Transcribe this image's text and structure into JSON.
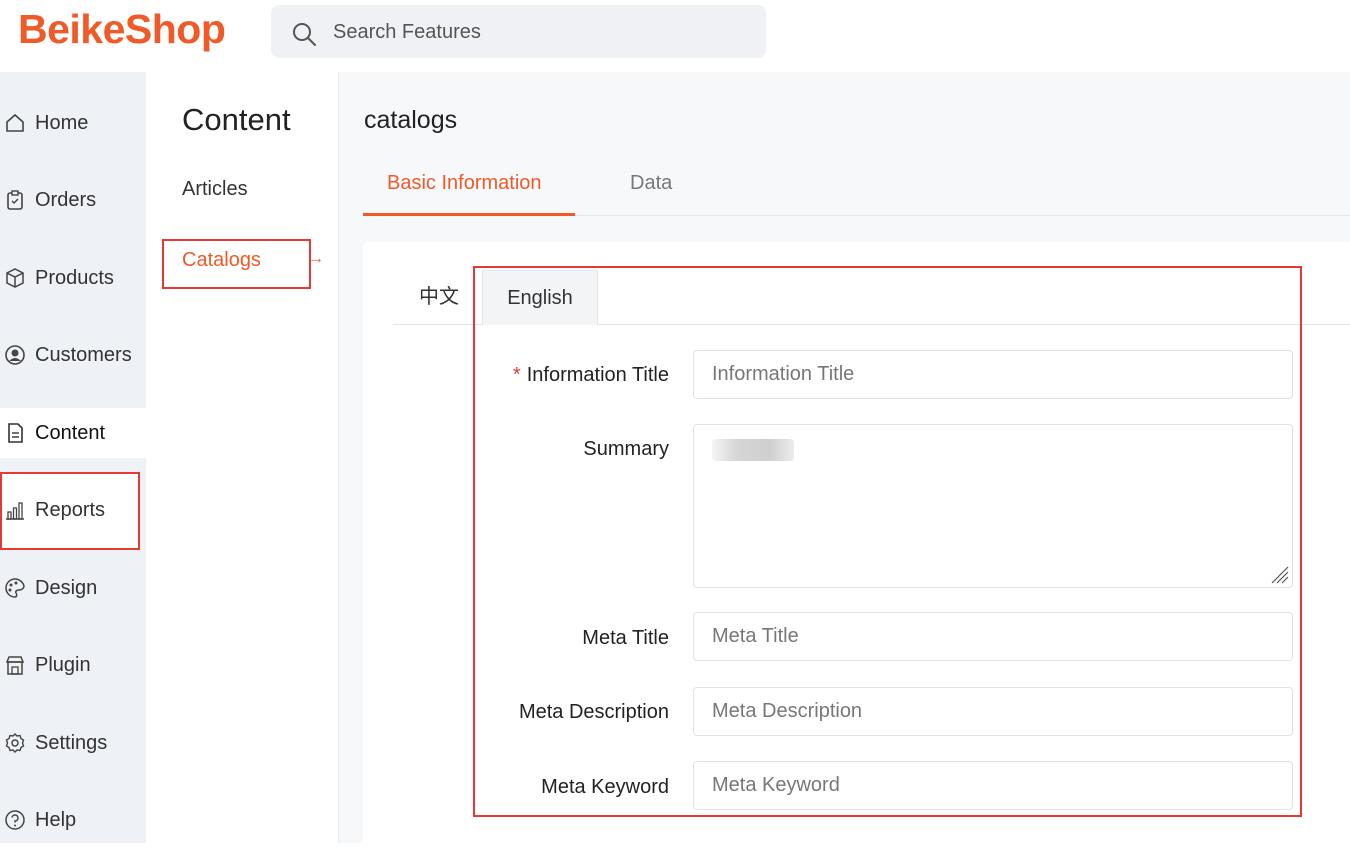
{
  "brand": {
    "logo_text": "BeikeShop",
    "accent": "#f05a28"
  },
  "search": {
    "placeholder": "Search Features"
  },
  "sidebar": {
    "items": [
      {
        "label": "Home",
        "icon": "home-icon"
      },
      {
        "label": "Orders",
        "icon": "clipboard-icon"
      },
      {
        "label": "Products",
        "icon": "box-icon"
      },
      {
        "label": "Customers",
        "icon": "user-circle-icon"
      },
      {
        "label": "Content",
        "icon": "document-icon"
      },
      {
        "label": "Reports",
        "icon": "bar-chart-icon"
      },
      {
        "label": "Design",
        "icon": "palette-icon"
      },
      {
        "label": "Plugin",
        "icon": "store-icon"
      },
      {
        "label": "Settings",
        "icon": "gear-icon"
      },
      {
        "label": "Help",
        "icon": "question-icon"
      }
    ],
    "active": "Content"
  },
  "subpanel": {
    "title": "Content",
    "links": [
      "Articles",
      "Catalogs"
    ],
    "active": "Catalogs",
    "arrow": "→"
  },
  "main": {
    "title": "catalogs",
    "tabs": [
      "Basic Information",
      "Data"
    ],
    "active_tab": "Basic Information",
    "lang_tabs": [
      "中文",
      "English"
    ],
    "active_lang": "English",
    "form": {
      "info_title_label": "Information Title",
      "info_title_placeholder": "Information Title",
      "summary_label": "Summary",
      "meta_title_label": "Meta Title",
      "meta_title_placeholder": "Meta Title",
      "meta_desc_label": "Meta Description",
      "meta_desc_placeholder": "Meta Description",
      "meta_keyword_label": "Meta Keyword",
      "meta_keyword_placeholder": "Meta Keyword"
    }
  }
}
